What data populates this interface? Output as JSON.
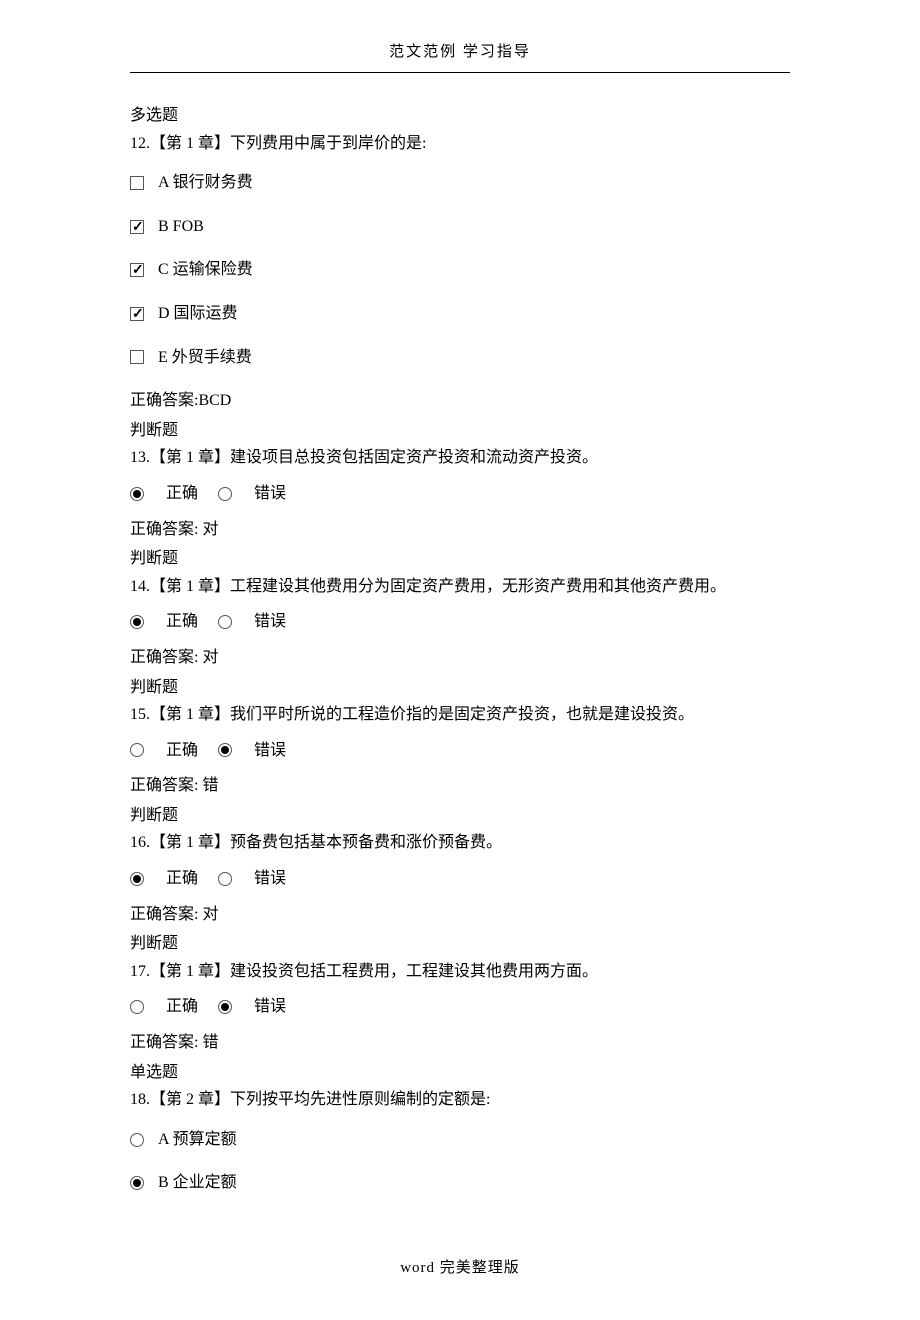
{
  "header": "范文范例   学习指导",
  "footer": "word 完美整理版",
  "q12": {
    "type": "多选题",
    "text": "12.【第 1 章】下列费用中属于到岸价的是:",
    "options": {
      "a": "A 银行财务费",
      "b": "B FOB",
      "c": "C 运输保险费",
      "d": "D 国际运费",
      "e": "E 外贸手续费"
    },
    "answer": "正确答案:BCD"
  },
  "q13": {
    "type": "判断题",
    "text": "13.【第 1 章】建设项目总投资包括固定资产投资和流动资产投资。",
    "opt_true": "正确",
    "opt_false": "错误",
    "answer": "正确答案: 对"
  },
  "q14": {
    "type": "判断题",
    "text": "14.【第 1 章】工程建设其他费用分为固定资产费用，无形资产费用和其他资产费用。",
    "opt_true": "正确",
    "opt_false": "错误",
    "answer": "正确答案: 对"
  },
  "q15": {
    "type": "判断题",
    "text": "15.【第 1 章】我们平时所说的工程造价指的是固定资产投资，也就是建设投资。",
    "opt_true": "正确",
    "opt_false": "错误",
    "answer": "正确答案: 错"
  },
  "q16": {
    "type": "判断题",
    "text": "16.【第 1 章】预备费包括基本预备费和涨价预备费。",
    "opt_true": "正确",
    "opt_false": "错误",
    "answer": "正确答案: 对"
  },
  "q17": {
    "type": "判断题",
    "text": "17.【第 1 章】建设投资包括工程费用，工程建设其他费用两方面。",
    "opt_true": "正确",
    "opt_false": "错误",
    "answer": "正确答案: 错"
  },
  "q18": {
    "type": "单选题",
    "text": "18.【第 2 章】下列按平均先进性原则编制的定额是:",
    "options": {
      "a": "A 预算定额",
      "b": "B 企业定额"
    }
  }
}
